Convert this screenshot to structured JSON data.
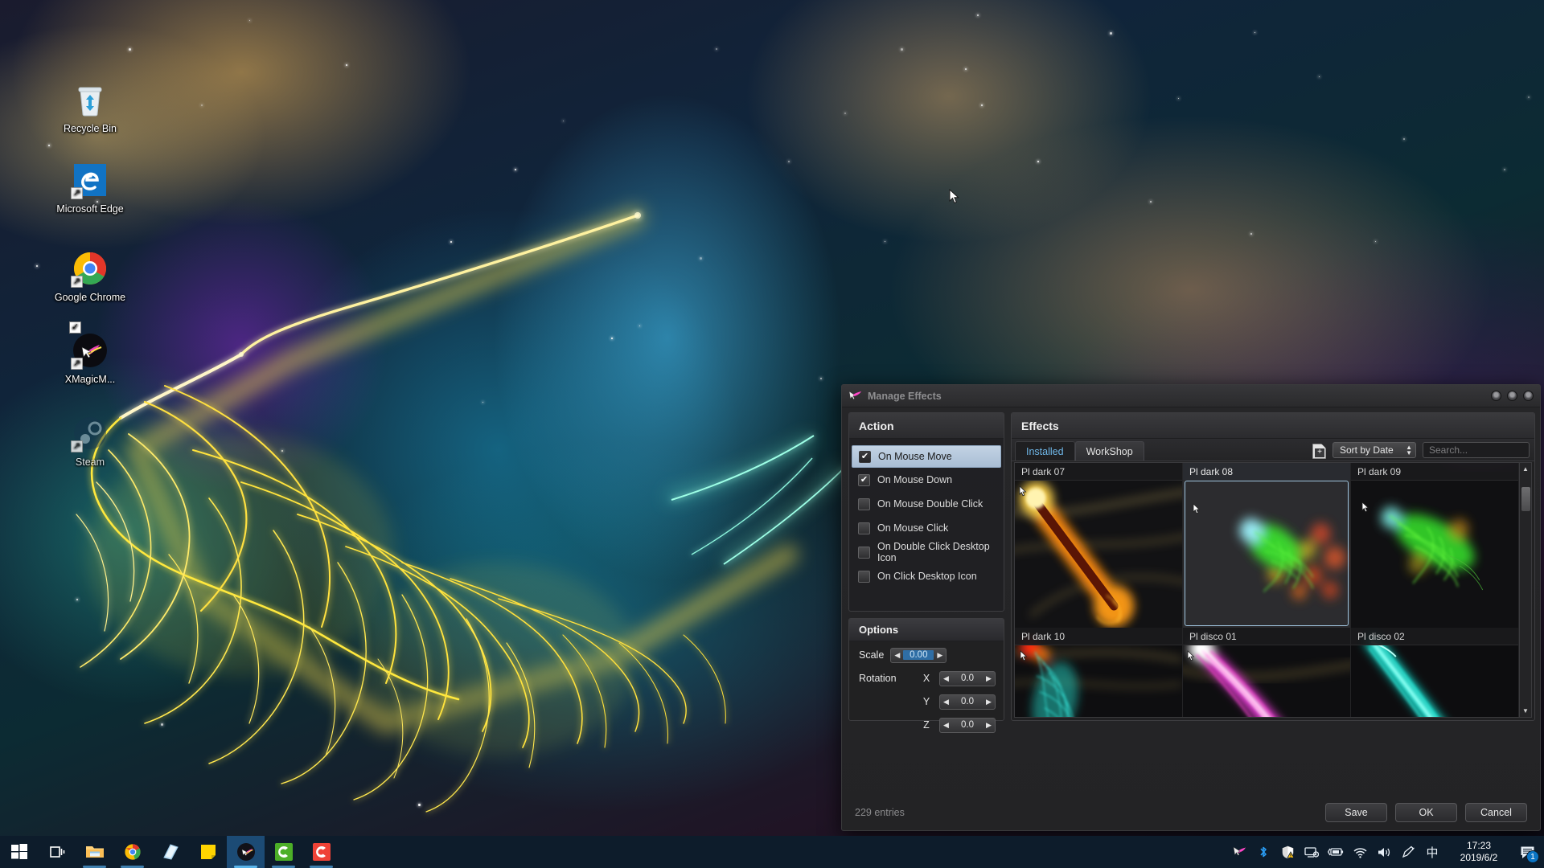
{
  "desktop": {
    "icons": [
      {
        "name": "Recycle Bin",
        "icon": "recycle-bin-icon",
        "shortcut": false,
        "checked": false
      },
      {
        "name": "Microsoft Edge",
        "icon": "microsoft-edge-icon",
        "shortcut": true,
        "checked": false
      },
      {
        "name": "Google Chrome",
        "icon": "google-chrome-icon",
        "shortcut": true,
        "checked": false
      },
      {
        "name": "XMagicM...",
        "icon": "xmagicmouse-icon",
        "shortcut": true,
        "checked": true
      },
      {
        "name": "Steam",
        "icon": "steam-icon",
        "shortcut": true,
        "checked": false
      }
    ]
  },
  "taskbar": {
    "buttons": [
      {
        "label": "Start",
        "icon": "windows-start-icon"
      },
      {
        "label": "Task View",
        "icon": "task-view-icon"
      },
      {
        "label": "File Explorer",
        "icon": "file-explorer-icon"
      },
      {
        "label": "Google Chrome",
        "icon": "google-chrome-icon"
      },
      {
        "label": "Sticky Notes",
        "icon": "sticky-notes-icon"
      },
      {
        "label": "Notepad",
        "icon": "yellow-note-icon"
      },
      {
        "label": "XMagicMouse",
        "icon": "xmagicmouse-icon"
      },
      {
        "label": "Camtasia",
        "icon": "green-c-icon"
      },
      {
        "label": "Camtasia Recorder",
        "icon": "red-c-icon"
      }
    ],
    "tray": [
      {
        "label": "XMagicMouse",
        "icon": "xmagicmouse-tray-icon"
      },
      {
        "label": "Bluetooth",
        "icon": "bluetooth-icon"
      },
      {
        "label": "Windows Security",
        "icon": "shield-warning-icon"
      },
      {
        "label": "Display",
        "icon": "monitor-icon"
      },
      {
        "label": "Power",
        "icon": "battery-charging-icon"
      },
      {
        "label": "Network",
        "icon": "wifi-icon"
      },
      {
        "label": "Volume",
        "icon": "speaker-icon"
      },
      {
        "label": "Pen / Ink",
        "icon": "pen-icon"
      },
      {
        "label": "IME Mode",
        "icon": "ime-chinese-icon",
        "glyph": "中"
      }
    ],
    "clock": {
      "time": "17:23",
      "date": "2019/6/2"
    },
    "notifications": {
      "icon": "action-center-icon",
      "count": "1"
    }
  },
  "dialog": {
    "title": "Manage Effects",
    "app_icon": "xmagicmouse-icon",
    "window_buttons": [
      "minimize-button",
      "maximize-button",
      "close-button"
    ],
    "action": {
      "header": "Action",
      "items": [
        {
          "label": "On Mouse Move",
          "checked": true,
          "selected": true
        },
        {
          "label": "On Mouse Down",
          "checked": true,
          "selected": false
        },
        {
          "label": "On Mouse Double Click",
          "checked": false,
          "selected": false
        },
        {
          "label": "On Mouse Click",
          "checked": false,
          "selected": false
        },
        {
          "label": "On Double Click Desktop Icon",
          "checked": false,
          "selected": false
        },
        {
          "label": "On Click Desktop Icon",
          "checked": false,
          "selected": false
        }
      ]
    },
    "options": {
      "header": "Options",
      "scale": {
        "label": "Scale",
        "value": "0.00",
        "highlighted": true
      },
      "rotation": {
        "label": "Rotation",
        "axes": [
          {
            "axis": "X",
            "value": "0.0"
          },
          {
            "axis": "Y",
            "value": "0.0"
          },
          {
            "axis": "Z",
            "value": "0.0"
          }
        ]
      }
    },
    "effects": {
      "header": "Effects",
      "tabs": [
        {
          "label": "Installed",
          "active": true
        },
        {
          "label": "WorkShop",
          "active": false
        }
      ],
      "add_button": "add-effect-icon",
      "sort": {
        "value": "Sort by Date"
      },
      "search": {
        "value": "",
        "placeholder": "Search...",
        "icon": "search-icon"
      },
      "items": [
        {
          "label": "Pl dark 07",
          "selected": false,
          "style": "fire-orange"
        },
        {
          "label": "Pl dark 08",
          "selected": true,
          "style": "green-cluster"
        },
        {
          "label": "Pl dark 09",
          "selected": false,
          "style": "green-comet"
        },
        {
          "label": "Pl dark 10",
          "selected": false,
          "style": "cyan-web"
        },
        {
          "label": "Pl disco 01",
          "selected": false,
          "style": "white-magenta"
        },
        {
          "label": "Pl disco 02",
          "selected": false,
          "style": "cyan-yellow"
        }
      ],
      "scroll": {
        "up": "scroll-up-arrow",
        "down": "scroll-down-arrow"
      }
    },
    "footer": {
      "entries": "229 entries",
      "buttons": [
        {
          "label": "Save",
          "name": "save-button"
        },
        {
          "label": "OK",
          "name": "ok-button"
        },
        {
          "label": "Cancel",
          "name": "cancel-button"
        }
      ]
    }
  }
}
